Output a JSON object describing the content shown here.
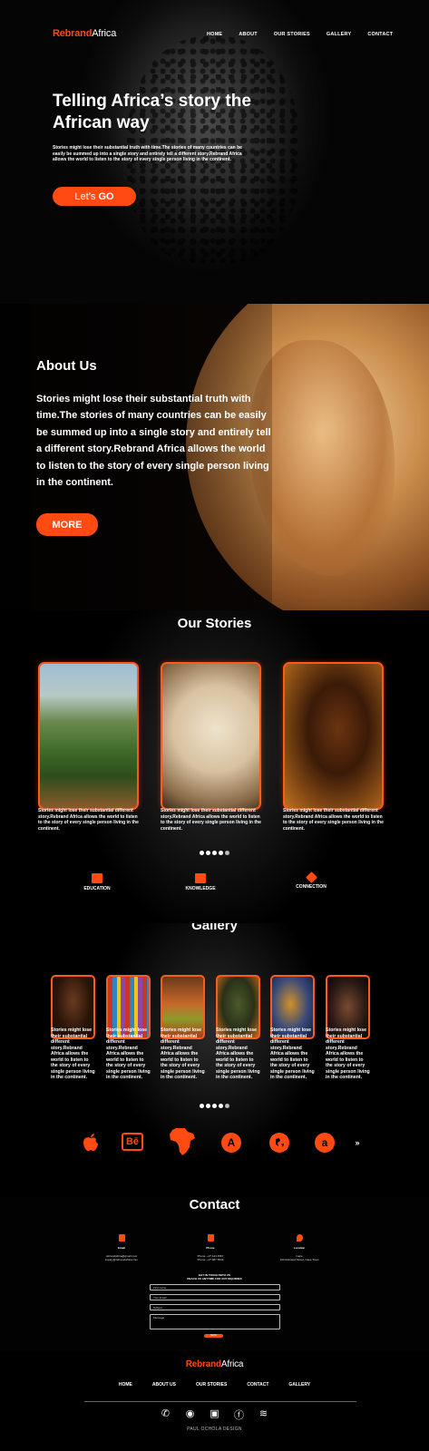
{
  "brand": {
    "part1": "Rebrand",
    "part2": "Africa"
  },
  "nav": [
    "HOME",
    "ABOUT",
    "OUR STORIES",
    "GALLERY",
    "CONTACT"
  ],
  "hero": {
    "title": "Telling Africa’s story the African way",
    "text": "Stories might lose their substantial truth with time.The stories of many countries can be easily be summed up into a single story and entirely tell a different story.Rebrand Africa allows the world to listen to the story of every single person living in the continent.",
    "button_prefix": "Let’s ",
    "button_strong": "GO"
  },
  "about": {
    "title": "About Us",
    "text": "Stories might lose their substantial truth with time.The stories of many countries can be easily be summed up into a single story and entirely tell a different story.Rebrand Africa allows the world to listen to the story of every single person living in the continent.",
    "button": "MORE"
  },
  "stories": {
    "title": "Our Stories",
    "cards": [
      {
        "image": "mountain-landscape",
        "text": "Stories might lose their substantial different story.Rebrand Africa allows the world to listen to the story of every single person living in the continent."
      },
      {
        "image": "globe-africa",
        "text": "Stories might lose their substantial different story.Rebrand Africa allows the world to listen to the story of every single person living in the continent."
      },
      {
        "image": "woman-headwrap",
        "text": "Stories might lose their substantial different story.Rebrand Africa allows the world to listen to the story of every single person living in the continent."
      }
    ],
    "features": [
      {
        "icon": "book-icon",
        "label": "EDUCATION"
      },
      {
        "icon": "knowledge-icon",
        "label": "KNOWLEDGE"
      },
      {
        "icon": "connection-icon",
        "label": "CONNECTION"
      }
    ]
  },
  "gallery": {
    "title": "Gallery",
    "caption": "Stories might lose their substantial different story.Rebrand Africa allows the world to listen to the story of every single person living in the continent.",
    "images": [
      "portrait-1",
      "textiles",
      "market-woman",
      "headwrap-portrait",
      "painted-face",
      "two-women"
    ],
    "socials": [
      "apple-icon",
      "behance-icon",
      "africa-map-icon",
      "app-store-icon",
      "globe-icon",
      "amazon-icon"
    ],
    "more": "»"
  },
  "contact": {
    "title": "Contact",
    "items": [
      {
        "icon": "mail-icon",
        "label": "Email",
        "value": "rebrandafrica@gmail.com\ninquiry@rebrandafrica.com"
      },
      {
        "icon": "phone-icon",
        "label": "Phone",
        "value": "Phone: +27 123 4567\nPhone: +27 987 6543"
      },
      {
        "icon": "location-icon",
        "label": "Location",
        "value": "Cape\n123 Rebrand Street, Cape Town"
      }
    ],
    "form_heading": "GET IN TOUCH WITH US\nREACH US ANYTIME FOR ANY INQUIRIES",
    "fields": [
      "First name",
      "Your Email",
      "Subject",
      "Message"
    ],
    "send": "SEND"
  },
  "footer": {
    "nav": [
      "HOME",
      "ABOUT US",
      "OUR STORIES",
      "CONTACT",
      "GALLERY"
    ],
    "icons": [
      "phone-icon",
      "whatsapp-icon",
      "instagram-icon",
      "facebook-icon",
      "spotify-icon"
    ],
    "credit": "PAUL OCHOLA DESIGN"
  },
  "colors": {
    "accent": "#ff4a12",
    "background": "#000000"
  }
}
